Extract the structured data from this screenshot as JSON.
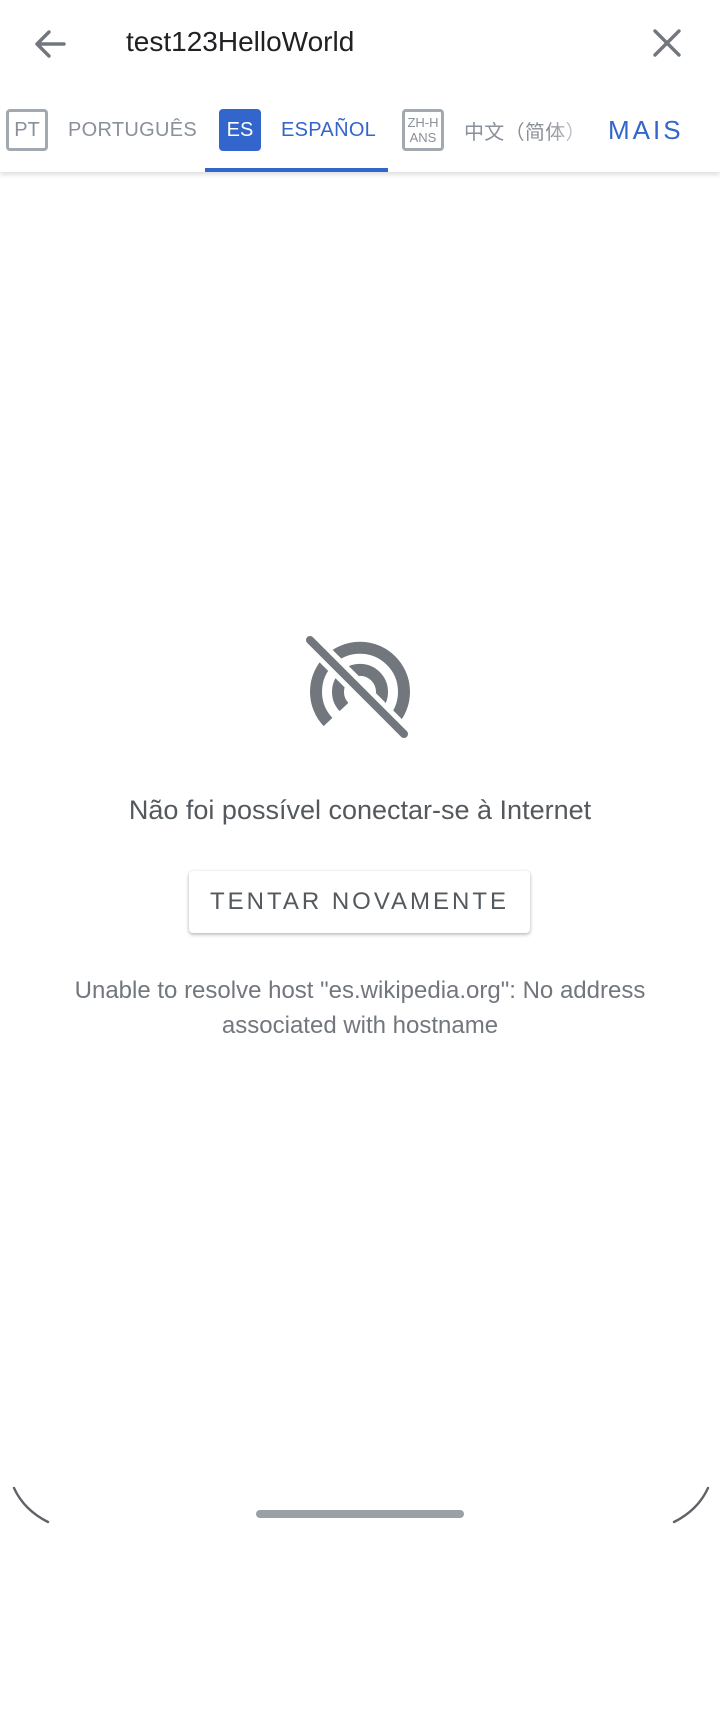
{
  "search": {
    "value": "test123HelloWorld",
    "placeholder": ""
  },
  "languages": {
    "tabs": [
      {
        "code": "PT",
        "name": "PORTUGUÊS",
        "selected": false
      },
      {
        "code": "ES",
        "name": "ESPAÑOL",
        "selected": true
      },
      {
        "code_line1": "ZH-H",
        "code_line2": "ANS",
        "name": "中文（简体）",
        "selected": false
      }
    ],
    "more_label": "MAIS"
  },
  "error": {
    "message": "Não foi possível conectar-se à Internet",
    "retry_label": "TENTAR NOVAMENTE",
    "details": "Unable to resolve host \"es.wikipedia.org\": No address associated with hostname"
  },
  "colors": {
    "accent": "#3366cc",
    "icon": "#72777d",
    "text_secondary": "#54595d"
  },
  "icons": {
    "back": "back-arrow-icon",
    "close": "close-icon",
    "offline": "no-connection-icon"
  }
}
